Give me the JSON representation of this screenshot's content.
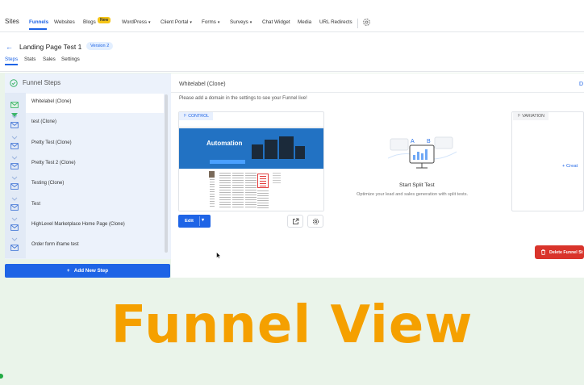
{
  "nav": {
    "brand": "Sites",
    "items": [
      {
        "label": "Funnels",
        "active": true
      },
      {
        "label": "Websites"
      },
      {
        "label": "Blogs"
      },
      {
        "label": "WordPress"
      },
      {
        "label": "Client Portal"
      },
      {
        "label": "Forms"
      },
      {
        "label": "Surveys"
      },
      {
        "label": "Chat Widget"
      },
      {
        "label": "Media"
      },
      {
        "label": "URL Redirects"
      }
    ],
    "blogs_badge": "New",
    "settings_icon": "gear-icon"
  },
  "header": {
    "back_icon": "arrow-left-icon",
    "title": "Landing Page Test 1",
    "version": "Version 2",
    "tabs": [
      "Steps",
      "Stats",
      "Sales",
      "Settings"
    ],
    "active_tab": "Steps"
  },
  "funnel_steps": {
    "title": "Funnel Steps",
    "steps": [
      "Whitelabel (Clone)",
      "test (Clone)",
      "Pretty Test (Clone)",
      "Pretty Test 2 (Clone)",
      "Testing (Clone)",
      "Test",
      "HighLevel Marketplace Home Page (Clone)",
      "Order form iframe test"
    ],
    "selected_index": 0,
    "add_button": "Add New Step"
  },
  "main": {
    "title": "Whitelabel (Clone)",
    "right_link_fragment": "D",
    "domain_note": "Please add a domain in the settings to see your Funnel live!",
    "control_label": "CONTROL",
    "thumbnail": {
      "hero_title": "Automation"
    },
    "edit_label": "Edit",
    "split": {
      "title": "Start Split Test",
      "subtitle": "Optimize your lead and sales generation with split tests.",
      "letters": [
        "A",
        "B"
      ]
    },
    "variation_label": "VARIATION",
    "variation_create": "+ Creat",
    "delete_label": "Delete Funnel St"
  },
  "caption": "Funnel View",
  "colors": {
    "primary": "#1e64e6",
    "danger": "#d9342b",
    "caption": "#f5a000",
    "background": "#eaf4ea"
  }
}
